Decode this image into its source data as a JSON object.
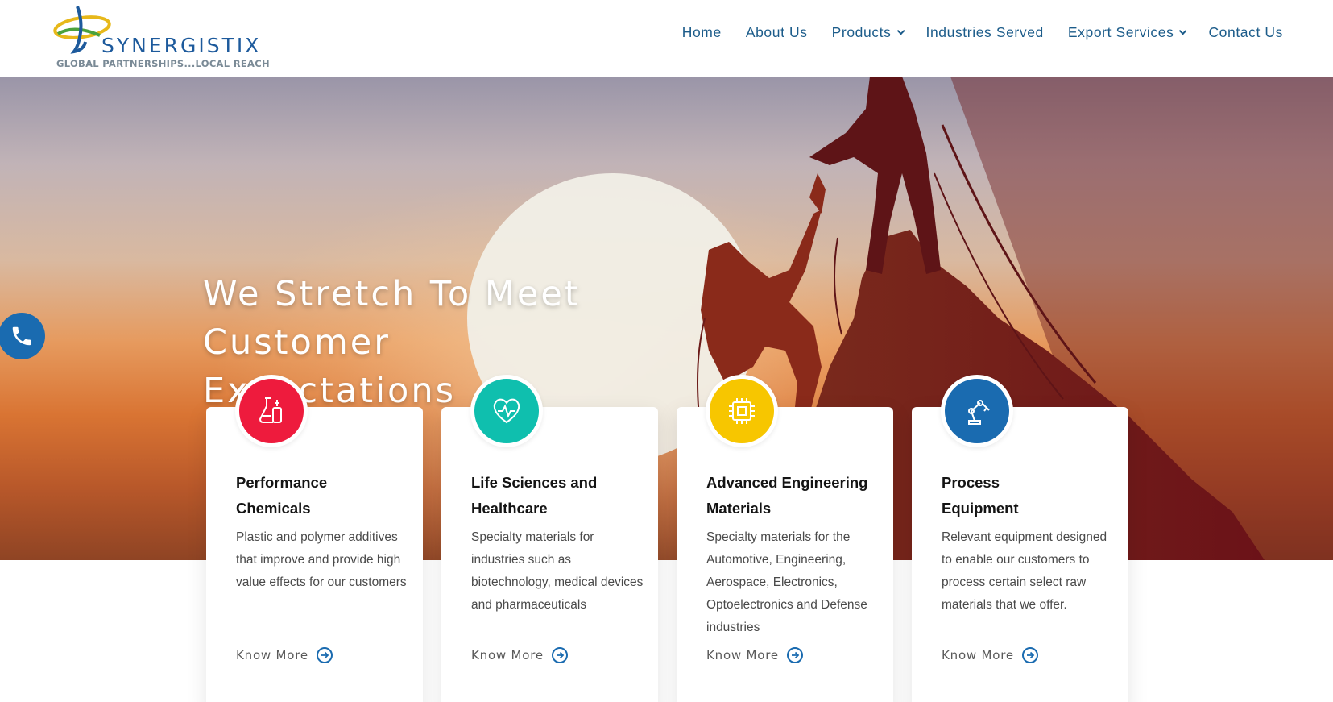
{
  "brand": {
    "name": "SYNERGISTIX",
    "tagline": "GLOBAL PARTNERSHIPS...LOCAL REACH",
    "colors": {
      "primary": "#1d5a9c",
      "accent_yellow": "#e7b81a",
      "accent_green": "#4ba23c"
    }
  },
  "nav": {
    "items": [
      {
        "label": "Home",
        "has_dropdown": false
      },
      {
        "label": "About Us",
        "has_dropdown": false
      },
      {
        "label": "Products",
        "has_dropdown": true
      },
      {
        "label": "Industries Served",
        "has_dropdown": false
      },
      {
        "label": "Export Services",
        "has_dropdown": true
      },
      {
        "label": "Contact Us",
        "has_dropdown": false
      }
    ]
  },
  "hero": {
    "title_line1": "We Stretch To Meet",
    "title_line2": "Customer Expectations"
  },
  "phone": {
    "icon": "phone-icon",
    "color": "#1a6bb0"
  },
  "cards": [
    {
      "icon": "chemistry-flask-icon",
      "icon_color": "#ee1b3d",
      "title_line1": "Performance",
      "title_line2": "Chemicals",
      "description": "Plastic and polymer additives that improve and provide high value effects for our customers",
      "link": "Know More"
    },
    {
      "icon": "heart-pulse-icon",
      "icon_color": "#0fbfae",
      "title_line1": "Life Sciences and",
      "title_line2": "Healthcare",
      "description": "Specialty materials for industries such as biotechnology, medical devices and pharmaceuticals",
      "link": "Know More"
    },
    {
      "icon": "microchip-icon",
      "icon_color": "#f7c600",
      "title_line1": "Advanced Engineering",
      "title_line2": "Materials",
      "description": "Specialty materials for the Automotive, Engineering, Aerospace, Electronics, Optoelectronics and Defense industries",
      "link": "Know More"
    },
    {
      "icon": "robotic-arm-icon",
      "icon_color": "#1a6bb0",
      "title_line1": "Process",
      "title_line2": "Equipment",
      "description": "Relevant equipment designed to enable our customers to process certain select raw materials that we offer.",
      "link": "Know More"
    }
  ]
}
